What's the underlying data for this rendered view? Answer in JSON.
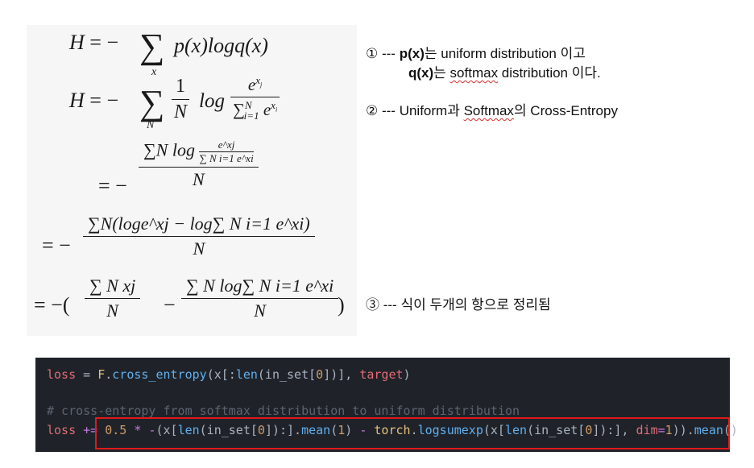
{
  "equations": {
    "eq1": {
      "lhs": "H",
      "minus": "= −",
      "sum": "∑",
      "sub": "x",
      "body": "p(x)logq(x)"
    },
    "eq2": {
      "lhs": "H",
      "minus": "= −",
      "sum": "∑",
      "sub": "N",
      "num": "1",
      "den": "N",
      "log": "log",
      "exp_num": "e",
      "exp_num_sup": "x",
      "exp_num_sub": "j",
      "exp_den": "∑",
      "exp_den_lim_lo": "i=1",
      "exp_den_lim_hi": "N",
      "exp_den_term": "e",
      "exp_den_sup": "x",
      "exp_den_subi": "i"
    },
    "eq3": {
      "minus": "= −",
      "num": "∑N log",
      "inner_num": "e^xj",
      "inner_den": "∑ N i=1 e^xi",
      "den": "N"
    },
    "eq4": {
      "minus": "= −",
      "num": "∑N(loge^xj − log∑ N i=1 e^xi)",
      "den": "N"
    },
    "eq5": {
      "minus": "= −(",
      "num1": "∑ N xj",
      "den1": "N",
      "op": "−",
      "num2": "∑ N log∑ N i=1 e^xi",
      "den2": "N",
      "close": ")"
    }
  },
  "notes": {
    "n1": {
      "marker": "①",
      "dash": "---",
      "bold1": "p(x)",
      "text1": "는 uniform distribution 이고"
    },
    "n1b": {
      "bold": "q(x)",
      "text_pre": "는 ",
      "squig": "softmax",
      "text_post": " distribution 이다."
    },
    "n2": {
      "marker": "②",
      "dash": "---",
      "pre": "Uniform과 ",
      "squig": "Softmax",
      "post": "의 Cross-Entropy"
    },
    "n3": {
      "marker": "③",
      "dash": "---",
      "text": "식이 두개의 항으로 정리됨"
    }
  },
  "code": {
    "line1": {
      "var": "loss",
      "eq": " = ",
      "mod": "F",
      "dot": ".",
      "fn": "cross_entropy",
      "rest_a": "(x[:",
      "fn2": "len",
      "rest_b": "(in_set[",
      "num": "0",
      "rest_c": "])], ",
      "arg": "target",
      "close": ")"
    },
    "comment": "# cross-entropy from softmax distribution to uniform distribution",
    "line3": {
      "var": "loss",
      "op": " += ",
      "num1": "0.5",
      "mul": " * ",
      "neg": "-",
      "p1": "(x[",
      "len1": "len",
      "p2": "(in_set[",
      "z1": "0",
      "p3": "]):].",
      "mean1": "mean",
      "p4": "(",
      "one": "1",
      "p5": ")",
      "minus": " - ",
      "torch": "torch",
      "dot": ".",
      "lse": "logsumexp",
      "p6": "(x[",
      "len2": "len",
      "p7": "(in_set[",
      "z2": "0",
      "p8": "]):], ",
      "dim": "dim",
      "eq": "=",
      "one2": "1",
      "p9": ")).",
      "mean2": "mean",
      "p10": "()"
    },
    "colors": {
      "background": "#1f2329",
      "highlight_border": "#e0191b"
    }
  }
}
